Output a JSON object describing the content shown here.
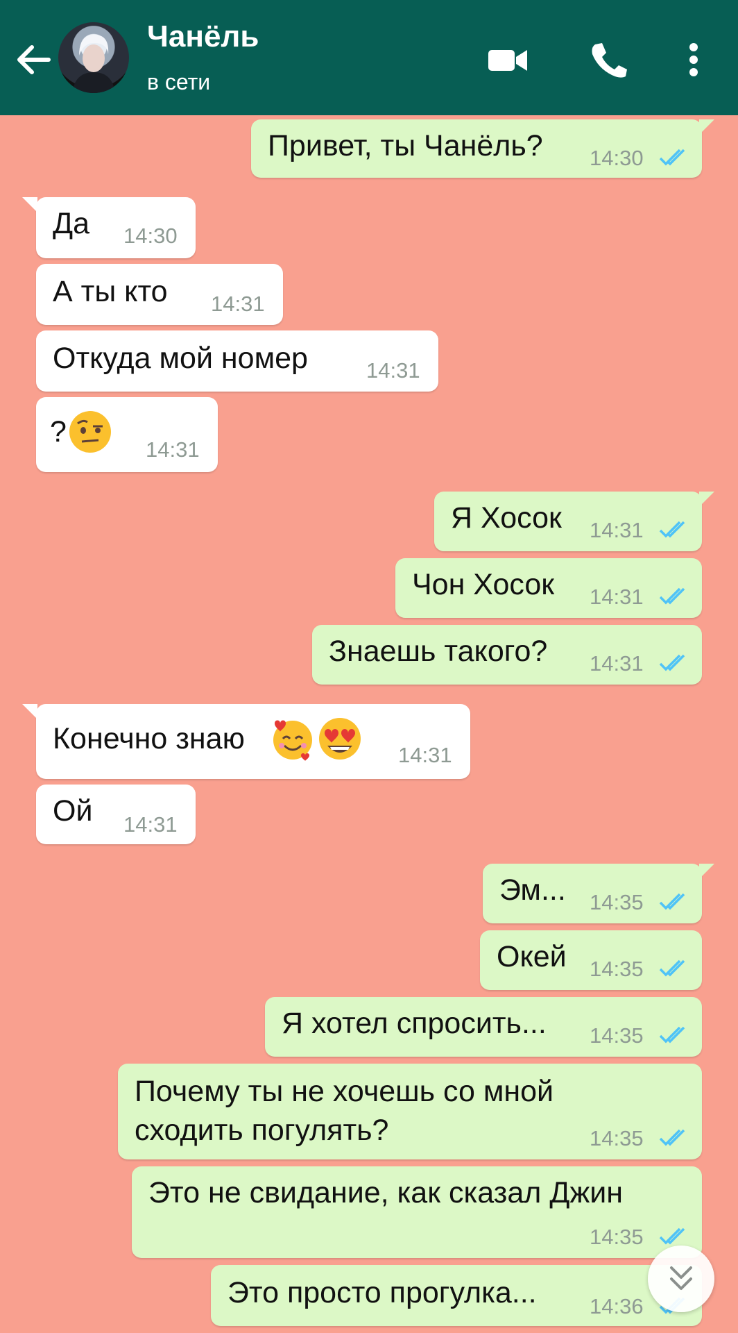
{
  "header": {
    "title": "Чанёль",
    "status": "в сети",
    "icons": [
      "back-arrow-icon",
      "avatar",
      "video-call-icon",
      "phone-icon",
      "more-vert-icon"
    ]
  },
  "colors": {
    "header_bg": "#075e54",
    "chat_bg": "#f9a08f",
    "outgoing_bubble": "#dcf8c6",
    "incoming_bubble": "#ffffff",
    "read_ticks": "#4fc3f7"
  },
  "messages": [
    {
      "dir": "out",
      "text": "Привет, ты Чанёль?",
      "time": "14:30"
    },
    {
      "dir": "in",
      "text": "Да",
      "time": "14:30"
    },
    {
      "dir": "in",
      "text": "А ты кто",
      "time": "14:31"
    },
    {
      "dir": "in",
      "text": "Откуда мой номер",
      "time": "14:31"
    },
    {
      "dir": "in",
      "text": "?",
      "emoji": [
        "raised-eyebrow-emoji"
      ],
      "time": "14:31"
    },
    {
      "dir": "out",
      "text": "Я Хосок",
      "time": "14:31"
    },
    {
      "dir": "out",
      "text": "Чон Хосок",
      "time": "14:31"
    },
    {
      "dir": "out",
      "text": "Знаешь такого?",
      "time": "14:31"
    },
    {
      "dir": "in",
      "text": "Конечно знаю",
      "emoji": [
        "smiling-face-with-hearts-emoji",
        "heart-eyes-emoji"
      ],
      "time": "14:31"
    },
    {
      "dir": "in",
      "text": "Ой",
      "time": "14:31"
    },
    {
      "dir": "out",
      "text": "Эм...",
      "time": "14:35"
    },
    {
      "dir": "out",
      "text": "Окей",
      "time": "14:35"
    },
    {
      "dir": "out",
      "text": "Я хотел спросить...",
      "time": "14:35"
    },
    {
      "dir": "out",
      "text": "Почему ты не хочешь со мной\nсходить погулять?",
      "time": "14:35"
    },
    {
      "dir": "out",
      "text": "Это не свидание, как сказал Джин",
      "time": "14:35"
    },
    {
      "dir": "out",
      "text": "Это просто прогулка...",
      "time": "14:36"
    }
  ],
  "scroll_down_icon": "double-chevron-down-icon"
}
